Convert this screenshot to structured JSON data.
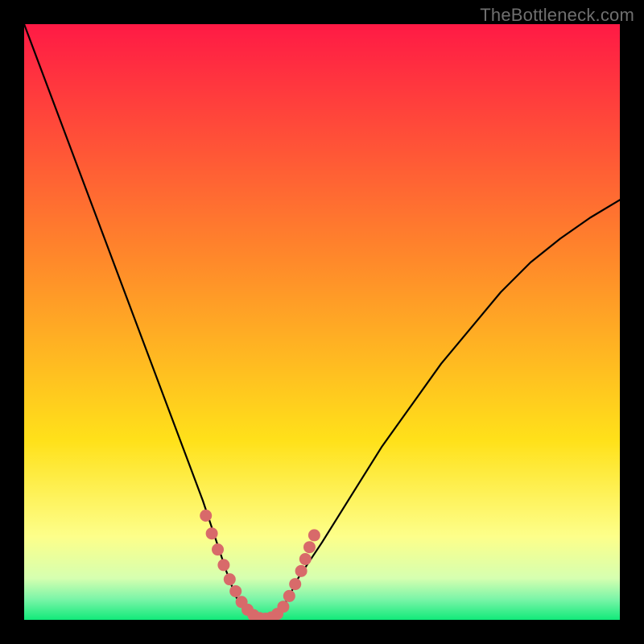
{
  "watermark": "TheBottleneck.com",
  "colors": {
    "grad_top": "#ff1a45",
    "grad_mid": "#ffe11a",
    "grad_lowband_top": "#fdff8a",
    "grad_bottom_band": "#11ea7a",
    "curve": "#000000",
    "dot": "#d86a6a",
    "page_bg": "#000000"
  },
  "chart_data": {
    "type": "line",
    "title": "",
    "xlabel": "",
    "ylabel": "",
    "xlim": [
      0,
      1
    ],
    "ylim": [
      0,
      1
    ],
    "series": [
      {
        "name": "bottleneck-curve",
        "x": [
          0.0,
          0.03,
          0.06,
          0.09,
          0.12,
          0.15,
          0.18,
          0.21,
          0.24,
          0.27,
          0.3,
          0.32,
          0.34,
          0.355,
          0.37,
          0.385,
          0.4,
          0.415,
          0.43,
          0.445,
          0.46,
          0.5,
          0.55,
          0.6,
          0.65,
          0.7,
          0.75,
          0.8,
          0.85,
          0.9,
          0.95,
          1.0
        ],
        "y": [
          1.0,
          0.92,
          0.84,
          0.76,
          0.68,
          0.6,
          0.52,
          0.44,
          0.36,
          0.28,
          0.2,
          0.14,
          0.08,
          0.04,
          0.015,
          0.005,
          0.0,
          0.005,
          0.015,
          0.04,
          0.07,
          0.13,
          0.21,
          0.29,
          0.36,
          0.43,
          0.49,
          0.55,
          0.6,
          0.64,
          0.675,
          0.705
        ]
      }
    ],
    "highlight_dots": {
      "x": [
        0.305,
        0.315,
        0.325,
        0.335,
        0.345,
        0.355,
        0.365,
        0.375,
        0.385,
        0.395,
        0.405,
        0.415,
        0.425,
        0.435,
        0.445,
        0.455,
        0.465,
        0.472,
        0.479,
        0.487
      ],
      "y": [
        0.175,
        0.145,
        0.118,
        0.092,
        0.068,
        0.048,
        0.03,
        0.017,
        0.008,
        0.003,
        0.002,
        0.004,
        0.01,
        0.022,
        0.04,
        0.06,
        0.082,
        0.102,
        0.122,
        0.142
      ]
    }
  }
}
